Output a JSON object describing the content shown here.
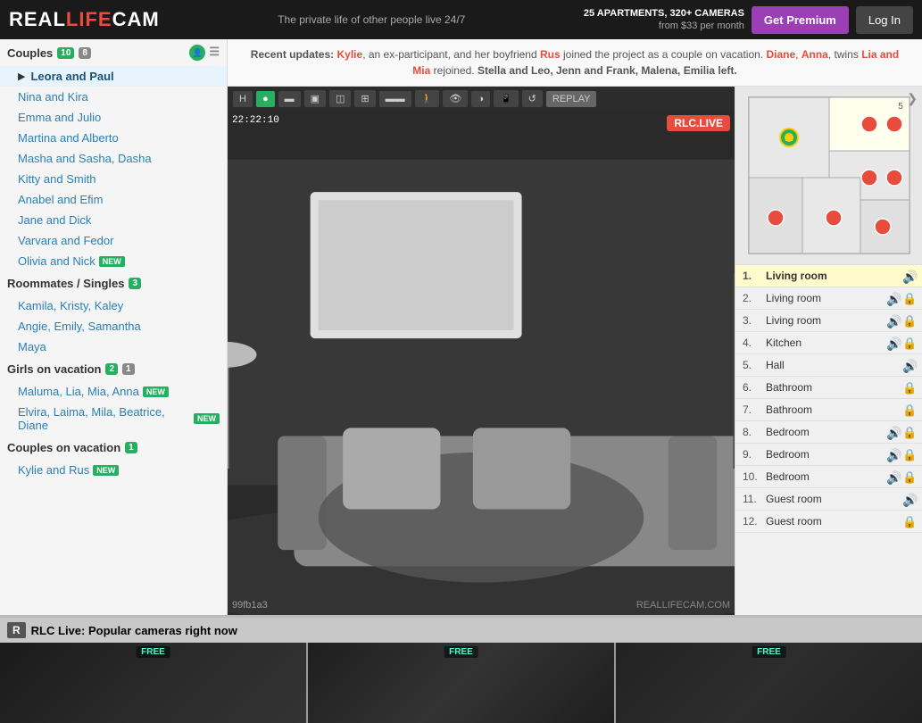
{
  "header": {
    "logo": "REALLIFECAM",
    "tagline": "The private life of other people live 24/7",
    "stats": "25 APARTMENTS, 320+ CAMERAS",
    "pricing": "from $33 per month",
    "get_premium": "Get Premium",
    "login": "Log In"
  },
  "sidebar": {
    "couples": {
      "label": "Couples",
      "count_green": "10",
      "count_gray": "8",
      "items": [
        {
          "name": "Leora and Paul",
          "active": true,
          "new": false
        },
        {
          "name": "Nina and Kira",
          "active": false,
          "new": false
        },
        {
          "name": "Emma and Julio",
          "active": false,
          "new": false
        },
        {
          "name": "Martina and Alberto",
          "active": false,
          "new": false
        },
        {
          "name": "Masha and Sasha, Dasha",
          "active": false,
          "new": false
        },
        {
          "name": "Kitty and Smith",
          "active": false,
          "new": false
        },
        {
          "name": "Anabel and Efim",
          "active": false,
          "new": false
        },
        {
          "name": "Jane and Dick",
          "active": false,
          "new": false
        },
        {
          "name": "Varvara and Fedor",
          "active": false,
          "new": false
        },
        {
          "name": "Olivia and Nick",
          "active": false,
          "new": true
        }
      ]
    },
    "roommates": {
      "label": "Roommates / Singles",
      "count_green": "3",
      "items": [
        {
          "name": "Kamila, Kristy, Kaley"
        },
        {
          "name": "Angie, Emily, Samantha"
        },
        {
          "name": "Maya"
        }
      ]
    },
    "girls": {
      "label": "Girls on vacation",
      "count_green": "2",
      "count_gray": "1",
      "items": [
        {
          "name": "Maluma, Lia, Mia, Anna",
          "new": true
        },
        {
          "name": "Elvira, Laima, Mila, Beatrice, Diane",
          "new": true
        }
      ]
    },
    "couples_vacation": {
      "label": "Couples on vacation",
      "count_green": "1",
      "items": [
        {
          "name": "Kylie and Rus",
          "new": true
        }
      ]
    }
  },
  "notice": {
    "text": "Recent updates: Kylie, an ex-participant, and her boyfriend Rus joined the project as a couple on vacation. Diane, Anna, twins Lia and Mia rejoined. Stella and Leo, Jenn and Frank, Malena, Emilia left.",
    "links": [
      "Kylie",
      "Rus",
      "Diane",
      "Anna",
      "twins Lia",
      "Mia",
      "Stella",
      "Leo",
      "Jenn",
      "Frank",
      "Malena",
      "Emilia"
    ]
  },
  "toolbar": {
    "buttons": [
      "H",
      "●",
      "▬",
      "▣",
      "◫",
      "⊞",
      "▬▬",
      "◉",
      "👁",
      "◑",
      "📱",
      "↺",
      "REPLAY"
    ]
  },
  "video": {
    "timestamp": "22:22:10",
    "live_label": "RLC.LIVE",
    "watermark": "REALLIFECAM.COM",
    "cam_id": "99fb1a3"
  },
  "rooms": [
    {
      "num": "1.",
      "name": "Living room",
      "active": true,
      "sound": true,
      "lock": false
    },
    {
      "num": "2.",
      "name": "Living room",
      "active": false,
      "sound": true,
      "lock": true
    },
    {
      "num": "3.",
      "name": "Living room",
      "active": false,
      "sound": true,
      "lock": true
    },
    {
      "num": "4.",
      "name": "Kitchen",
      "active": false,
      "sound": true,
      "lock": true
    },
    {
      "num": "5.",
      "name": "Hall",
      "active": false,
      "sound": true,
      "lock": false
    },
    {
      "num": "6.",
      "name": "Bathroom",
      "active": false,
      "sound": false,
      "lock": true
    },
    {
      "num": "7.",
      "name": "Bathroom",
      "active": false,
      "sound": false,
      "lock": true
    },
    {
      "num": "8.",
      "name": "Bedroom",
      "active": false,
      "sound": true,
      "lock": true
    },
    {
      "num": "9.",
      "name": "Bedroom",
      "active": false,
      "sound": true,
      "lock": true
    },
    {
      "num": "10.",
      "name": "Bedroom",
      "active": false,
      "sound": true,
      "lock": true
    },
    {
      "num": "11.",
      "name": "Guest room",
      "active": false,
      "sound": true,
      "lock": false
    },
    {
      "num": "12.",
      "name": "Guest room",
      "active": false,
      "sound": false,
      "lock": true
    }
  ],
  "bottom": {
    "label": "RLC Live: Popular cameras right now",
    "icon": "R",
    "thumbnails": [
      {
        "label": "FREE"
      },
      {
        "label": "FREE"
      },
      {
        "label": "FREE"
      }
    ]
  }
}
